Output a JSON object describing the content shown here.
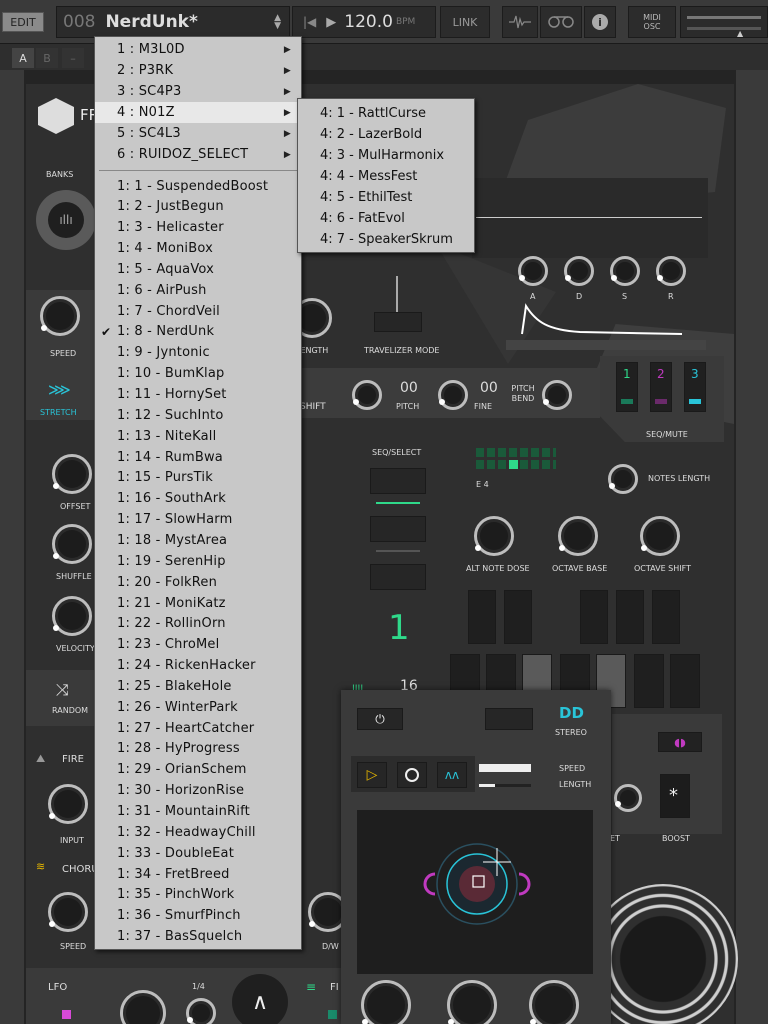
{
  "toolbar": {
    "edit_label": "EDIT",
    "preset_number": "008",
    "preset_name": "NerdUnk*",
    "bpm": "120.0",
    "bpm_unit": "BPM",
    "link_label": "LINK",
    "midi_label": "MIDI",
    "osc_label": "OSC"
  },
  "tabs": [
    "A",
    "B",
    "–"
  ],
  "panel": {
    "logo_text": "FR",
    "banks_label": "BANKS",
    "speed_label": "SPEED",
    "stretch_label": "STRETCH",
    "offset_label": "OFFSET",
    "shuffle_label": "SHUFFLE",
    "velocity_label": "VELOCITY",
    "random_label": "RANDOM",
    "fire_label": "FIRE",
    "input_label": "INPUT",
    "chorus_label": "CHORU",
    "speed2_label": "SPEED",
    "lfo_label": "LFO",
    "lfo_rate": "1/4",
    "length_label": "LENGTH",
    "travelizer_label": "TRAVELIZER MODE",
    "shift_label": "SHIFT",
    "pitch_value": "00",
    "pitch_label": "PITCH",
    "fine_value": "00",
    "fine_label": "FINE",
    "pitch_bend_label": "PITCH BEND",
    "adsr": [
      "A",
      "D",
      "S",
      "R"
    ],
    "seq_select_label": "SEQ/SELECT",
    "seq_note": "E 4",
    "seq_mute_label": "SEQ/MUTE",
    "seq_mute_nums": [
      "1",
      "2",
      "3"
    ],
    "notes_length_label": "NOTES LENGTH",
    "alt_note_dose_label": "ALT NOTE DOSE",
    "octave_base_label": "OCTAVE BASE",
    "octave_shift_label": "OCTAVE SHIFT",
    "big_number": "1",
    "steps_value": "16",
    "boost_label": "BOOST",
    "boost_symbol": "*",
    "dw_label": "D/W",
    "et_label": "ET",
    "fi_label": "FI"
  },
  "float_panel": {
    "stereo_label": "STEREO",
    "speed_label": "SPEED",
    "length_label": "LENGTH"
  },
  "colors": {
    "accent_cyan": "#29c4d8",
    "accent_green": "#2fd98a",
    "accent_magenta": "#c03ac0",
    "play_yellow": "#e8b800",
    "menu_bg": "#c8c8c8"
  },
  "main_menu": {
    "banks": [
      {
        "label": "1 : M3L0D"
      },
      {
        "label": "2 : P3RK"
      },
      {
        "label": "3 : SC4P3"
      },
      {
        "label": "4 : N01Z"
      },
      {
        "label": "5 : SC4L3"
      },
      {
        "label": "6 : RUIDOZ_SELECT"
      }
    ],
    "highlighted_bank": "4 : N01Z",
    "checked_preset": "1: 8 - NerdUnk",
    "presets": [
      "1: 1 - SuspendedBoost",
      "1: 2 - JustBegun",
      "1: 3 - Helicaster",
      "1: 4 - MoniBox",
      "1: 5 - AquaVox",
      "1: 6 - AirPush",
      "1: 7 - ChordVeil",
      "1: 8 - NerdUnk",
      "1: 9 - Jyntonic",
      "1: 10 - BumKlap",
      "1: 11 - HornySet",
      "1: 12 - SuchInto",
      "1: 13 - NiteKall",
      "1: 14 - RumBwa",
      "1: 15 - PursTik",
      "1: 16 - SouthArk",
      "1: 17 - SlowHarm",
      "1: 18 - MystArea",
      "1: 19 - SerenHip",
      "1: 20 - FolkRen",
      "1: 21 - MoniKatz",
      "1: 22 - RollinOrn",
      "1: 23 - ChroMel",
      "1: 24 - RickenHacker",
      "1: 25 - BlakeHole",
      "1: 26 - WinterPark",
      "1: 27 - HeartCatcher",
      "1: 28 - HyProgress",
      "1: 29 - OrianSchem",
      "1: 30 - HorizonRise",
      "1: 31 - MountainRift",
      "1: 32 - HeadwayChill",
      "1: 33 - DoubleEat",
      "1: 34 - FretBreed",
      "1: 35 - PinchWork",
      "1: 36 - SmurfPinch",
      "1: 37 - BasSquelch"
    ]
  },
  "sub_menu": {
    "items": [
      "4: 1 - RattlCurse",
      "4: 2 - LazerBold",
      "4: 3 - MulHarmonix",
      "4: 4 - MessFest",
      "4: 5 - EthilTest",
      "4: 6 - FatEvol",
      "4: 7 - SpeakerSkrum"
    ]
  }
}
